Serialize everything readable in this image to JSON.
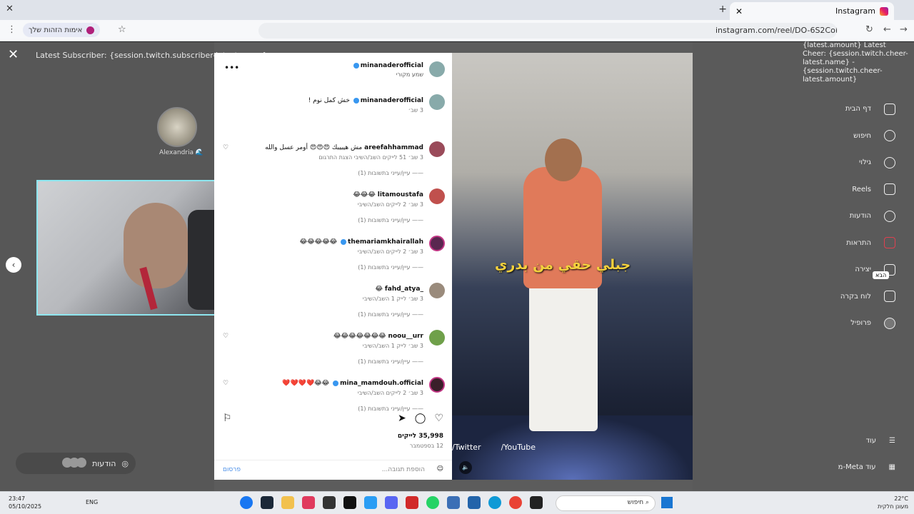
{
  "browser": {
    "tab_title": "Instagram",
    "url": "instagram.com/reel/DO-6S2CoKU",
    "identity_chip": "אימות הזהות שלך"
  },
  "overlay": {
    "latest_subscriber": "Latest Subscriber: {session.twitch.subscriber-latest.name}",
    "latest_cheer": "{latest.amount} Latest Cheer: {session.twitch.cheer-latest.name} - {session.twitch.cheer-latest.amount}",
    "viewer_name": "Alexandria 🌊",
    "messages_label": "הודעות"
  },
  "post": {
    "username": "minanaderofficial",
    "subtitle": "שמע מקורי",
    "comments": [
      {
        "user": "minanaderofficial",
        "text": "خش كمل نوم !",
        "meta": "3 שב׳",
        "replies": ""
      },
      {
        "user": "areefahhammad",
        "text": "مش هيبيبك 😍😍😍 أومر عسل والله",
        "meta": "3 שב׳   51 לייקים   השב/השיבי   הצגת התרגום",
        "replies": "——  עיין/עייני בתשובות (1)"
      },
      {
        "user": "litamoustafa",
        "text": "😂😂😂",
        "meta": "3 שב׳   2 לייקים   השב/השיבי",
        "replies": "——  עיין/עייני בתשובות (1)"
      },
      {
        "user": "themariamkhairallah",
        "text": "😂😂😂😂😂",
        "meta": "3 שב׳   2 לייקים   השב/השיבי",
        "replies": "——  עיין/עייני בתשובות (1)"
      },
      {
        "user": "_fahd_atya",
        "text": "😂",
        "meta": "3 שב׳   לייק 1   השב/השיבי",
        "replies": "——  עיין/עייני בתשובות (1)"
      },
      {
        "user": "noou__urr",
        "text": "😂😂😂😂😂😂😂",
        "meta": "3 שב׳   לייק 1   השב/השיבי",
        "replies": "——  עיין/עייני בתשובות (1)"
      },
      {
        "user": "mina_mamdouh.official",
        "text": "😂😂❤️❤️❤️❤️",
        "meta": "3 שב׳   2 לייקים   השב/השיבי",
        "replies": "——  עיין/עייני בתשובות (1)"
      }
    ],
    "likes": "35,998 לייקים",
    "date": "12 בספטמבר",
    "add_comment_placeholder": "הוספת תגובה...",
    "post_button": "פרסום"
  },
  "video": {
    "caption": "جبلي حقي من بدري",
    "twitter": "/Twitter",
    "youtube": "/YouTube"
  },
  "ig_nav": {
    "items": [
      "דף הבית",
      "חיפוש",
      "גילוי",
      "Reels",
      "הודעות",
      "התראות",
      "יצירה",
      "לוח בקרה",
      "פרופיל"
    ],
    "more": "עוד",
    "meta": "עוד Meta-מ",
    "tooltip": "הבא"
  },
  "taskbar": {
    "time": "23:47",
    "date": "05/10/2025",
    "lang": "ENG",
    "search": "חיפוש",
    "weather_temp": "22°C",
    "weather_desc": "מעונן חלקית"
  }
}
